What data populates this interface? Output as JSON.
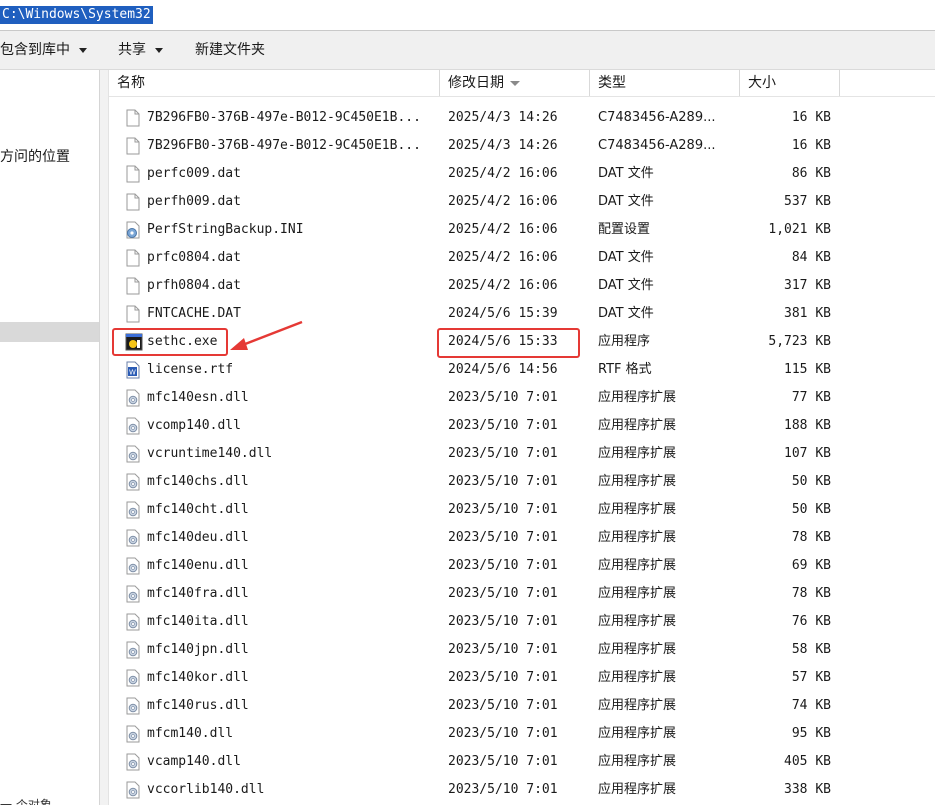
{
  "address": {
    "path": "C:\\Windows\\System32"
  },
  "toolbar": {
    "include_library": "包含到库中",
    "share": "共享",
    "new_folder": "新建文件夹"
  },
  "nav": {
    "location_text": "方问的位置",
    "bottom_text": "一 个对象"
  },
  "columns": {
    "name": "名称",
    "date": "修改日期",
    "type": "类型",
    "size": "大小"
  },
  "highlight_color": "#e53935",
  "files": [
    {
      "name": "7B296FB0-376B-497e-B012-9C450E1B...",
      "date": "2025/4/3 14:26",
      "type": "C7483456-A289...",
      "size": "16 KB",
      "icon": "blank-file-icon"
    },
    {
      "name": "7B296FB0-376B-497e-B012-9C450E1B...",
      "date": "2025/4/3 14:26",
      "type": "C7483456-A289...",
      "size": "16 KB",
      "icon": "blank-file-icon"
    },
    {
      "name": "perfc009.dat",
      "date": "2025/4/2 16:06",
      "type": "DAT 文件",
      "size": "86 KB",
      "icon": "blank-file-icon"
    },
    {
      "name": "perfh009.dat",
      "date": "2025/4/2 16:06",
      "type": "DAT 文件",
      "size": "537 KB",
      "icon": "blank-file-icon"
    },
    {
      "name": "PerfStringBackup.INI",
      "date": "2025/4/2 16:06",
      "type": "配置设置",
      "size": "1,021 KB",
      "icon": "settings-file-icon"
    },
    {
      "name": "prfc0804.dat",
      "date": "2025/4/2 16:06",
      "type": "DAT 文件",
      "size": "84 KB",
      "icon": "blank-file-icon"
    },
    {
      "name": "prfh0804.dat",
      "date": "2025/4/2 16:06",
      "type": "DAT 文件",
      "size": "317 KB",
      "icon": "blank-file-icon"
    },
    {
      "name": "FNTCACHE.DAT",
      "date": "2024/5/6 15:39",
      "type": "DAT 文件",
      "size": "381 KB",
      "icon": "blank-file-icon"
    },
    {
      "name": "sethc.exe",
      "date": "2024/5/6 15:33",
      "type": "应用程序",
      "size": "5,723 KB",
      "icon": "exe-icon"
    },
    {
      "name": "license.rtf",
      "date": "2024/5/6 14:56",
      "type": "RTF 格式",
      "size": "115 KB",
      "icon": "rtf-document-icon"
    },
    {
      "name": "mfc140esn.dll",
      "date": "2023/5/10 7:01",
      "type": "应用程序扩展",
      "size": "77 KB",
      "icon": "dll-icon"
    },
    {
      "name": "vcomp140.dll",
      "date": "2023/5/10 7:01",
      "type": "应用程序扩展",
      "size": "188 KB",
      "icon": "dll-icon"
    },
    {
      "name": "vcruntime140.dll",
      "date": "2023/5/10 7:01",
      "type": "应用程序扩展",
      "size": "107 KB",
      "icon": "dll-icon"
    },
    {
      "name": "mfc140chs.dll",
      "date": "2023/5/10 7:01",
      "type": "应用程序扩展",
      "size": "50 KB",
      "icon": "dll-icon"
    },
    {
      "name": "mfc140cht.dll",
      "date": "2023/5/10 7:01",
      "type": "应用程序扩展",
      "size": "50 KB",
      "icon": "dll-icon"
    },
    {
      "name": "mfc140deu.dll",
      "date": "2023/5/10 7:01",
      "type": "应用程序扩展",
      "size": "78 KB",
      "icon": "dll-icon"
    },
    {
      "name": "mfc140enu.dll",
      "date": "2023/5/10 7:01",
      "type": "应用程序扩展",
      "size": "69 KB",
      "icon": "dll-icon"
    },
    {
      "name": "mfc140fra.dll",
      "date": "2023/5/10 7:01",
      "type": "应用程序扩展",
      "size": "78 KB",
      "icon": "dll-icon"
    },
    {
      "name": "mfc140ita.dll",
      "date": "2023/5/10 7:01",
      "type": "应用程序扩展",
      "size": "76 KB",
      "icon": "dll-icon"
    },
    {
      "name": "mfc140jpn.dll",
      "date": "2023/5/10 7:01",
      "type": "应用程序扩展",
      "size": "58 KB",
      "icon": "dll-icon"
    },
    {
      "name": "mfc140kor.dll",
      "date": "2023/5/10 7:01",
      "type": "应用程序扩展",
      "size": "57 KB",
      "icon": "dll-icon"
    },
    {
      "name": "mfc140rus.dll",
      "date": "2023/5/10 7:01",
      "type": "应用程序扩展",
      "size": "74 KB",
      "icon": "dll-icon"
    },
    {
      "name": "mfcm140.dll",
      "date": "2023/5/10 7:01",
      "type": "应用程序扩展",
      "size": "95 KB",
      "icon": "dll-icon"
    },
    {
      "name": "vcamp140.dll",
      "date": "2023/5/10 7:01",
      "type": "应用程序扩展",
      "size": "405 KB",
      "icon": "dll-icon"
    },
    {
      "name": "vccorlib140.dll",
      "date": "2023/5/10 7:01",
      "type": "应用程序扩展",
      "size": "338 KB",
      "icon": "dll-icon"
    }
  ]
}
